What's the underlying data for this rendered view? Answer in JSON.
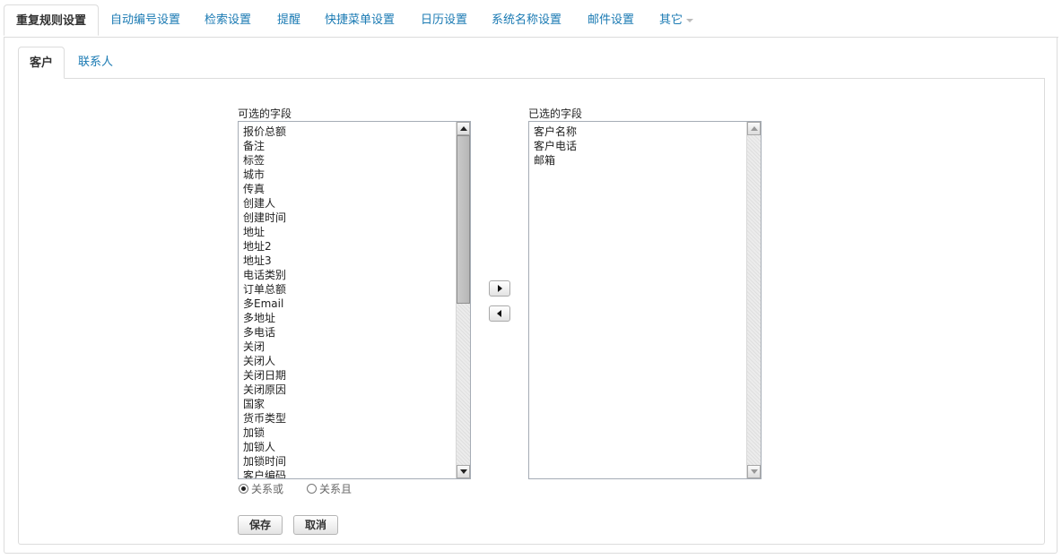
{
  "top_tabs": [
    {
      "label": "重复规则设置",
      "active": true
    },
    {
      "label": "自动编号设置"
    },
    {
      "label": "检索设置"
    },
    {
      "label": "提醒"
    },
    {
      "label": "快捷菜单设置"
    },
    {
      "label": "日历设置"
    },
    {
      "label": "系统名称设置"
    },
    {
      "label": "邮件设置"
    },
    {
      "label": "其它",
      "has_dropdown": true
    }
  ],
  "inner_tabs": [
    {
      "label": "客户",
      "active": true
    },
    {
      "label": "联系人"
    }
  ],
  "available": {
    "label": "可选的字段",
    "items": [
      "报价总额",
      "备注",
      "标签",
      "城市",
      "传真",
      "创建人",
      "创建时间",
      "地址",
      "地址2",
      "地址3",
      "电话类别",
      "订单总额",
      "多Email",
      "多地址",
      "多电话",
      "关闭",
      "关闭人",
      "关闭日期",
      "关闭原因",
      "国家",
      "货币类型",
      "加锁",
      "加锁人",
      "加锁时间",
      "客户编码"
    ]
  },
  "selected": {
    "label": "已选的字段",
    "items": [
      "客户名称",
      "客户电话",
      "邮箱"
    ]
  },
  "relation": {
    "options": [
      "关系或",
      "关系且"
    ],
    "selected": "关系或"
  },
  "buttons": {
    "save": "保存",
    "cancel": "取消"
  },
  "colors": {
    "link": "#1a7ab3",
    "border": "#dcdcdc"
  }
}
